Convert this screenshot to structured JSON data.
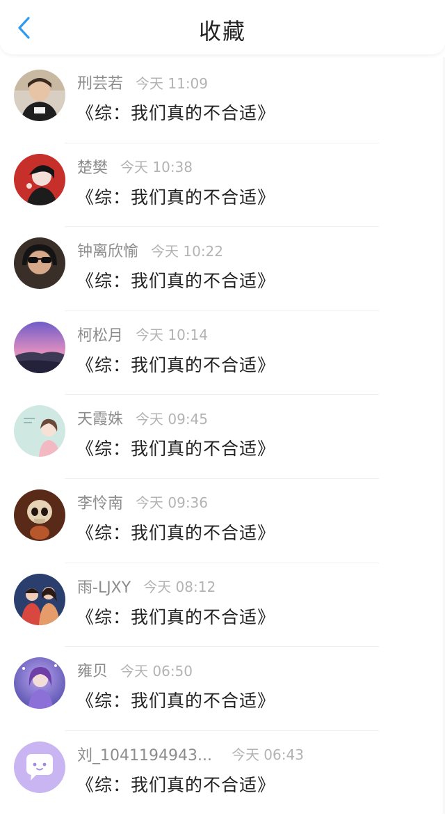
{
  "header": {
    "title": "收藏",
    "accent": "#2e9bf0"
  },
  "items": [
    {
      "name": "刑芸若",
      "time": "今天 11:09",
      "book": "《综：我们真的不合适》",
      "avatar": "boy-photo"
    },
    {
      "name": "楚樊",
      "time": "今天 10:38",
      "book": "《综：我们真的不合适》",
      "avatar": "anime-red"
    },
    {
      "name": "钟离欣愉",
      "time": "今天 10:22",
      "book": "《综：我们真的不合适》",
      "avatar": "sunglasses-girl"
    },
    {
      "name": "柯松月",
      "time": "今天 10:14",
      "book": "《综：我们真的不合适》",
      "avatar": "sunset-landscape"
    },
    {
      "name": "天霞姝",
      "time": "今天 09:45",
      "book": "《综：我们真的不合适》",
      "avatar": "mint-girl"
    },
    {
      "name": "李怜南",
      "time": "今天 09:36",
      "book": "《综：我们真的不合适》",
      "avatar": "skull-figure"
    },
    {
      "name": "雨-LJXY",
      "time": "今天 08:12",
      "book": "《综：我们真的不合适》",
      "avatar": "couple-illustration"
    },
    {
      "name": "雍贝",
      "time": "今天 06:50",
      "book": "《综：我们真的不合适》",
      "avatar": "purple-girl"
    },
    {
      "name": "刘_1041194943...",
      "time": "今天 06:43",
      "book": "《综：我们真的不合适》",
      "avatar": "default-chat-bubble"
    }
  ]
}
